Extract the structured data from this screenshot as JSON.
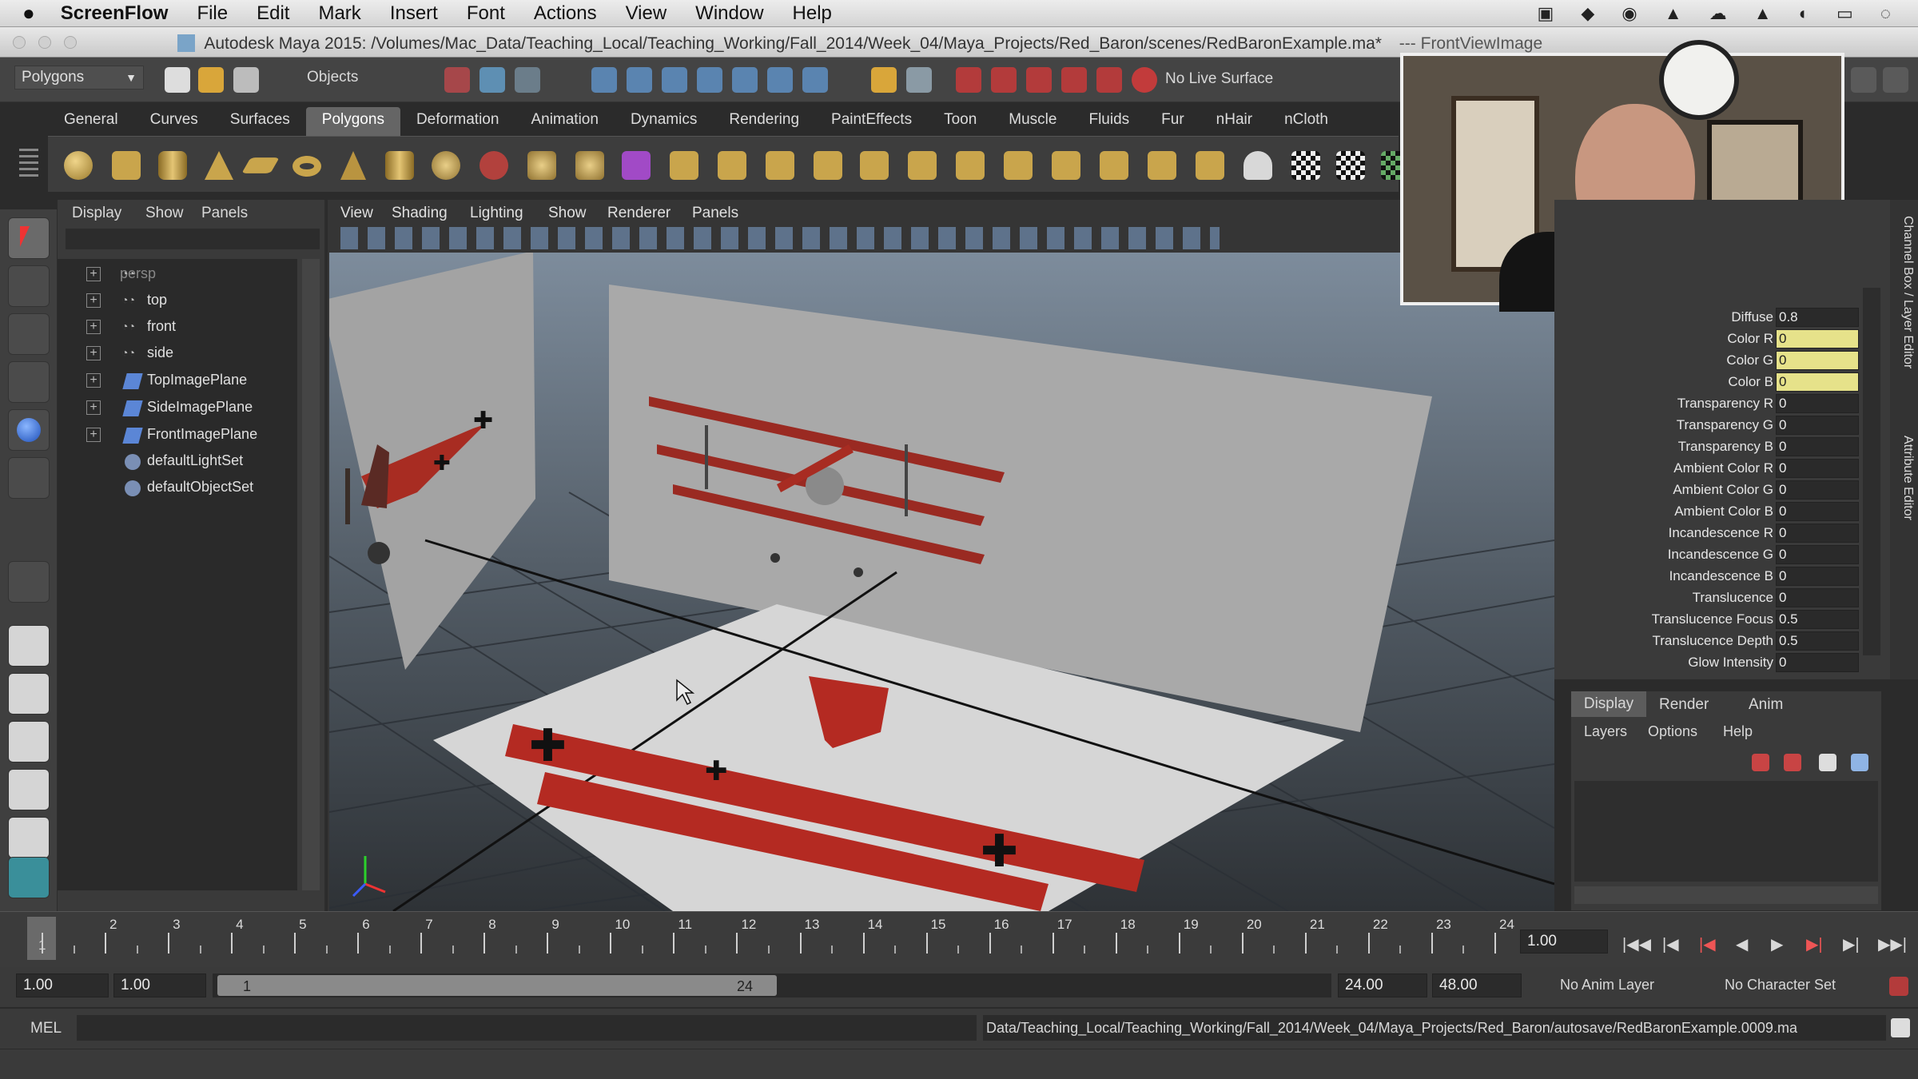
{
  "menubar": {
    "app": "ScreenFlow",
    "items": [
      "File",
      "Edit",
      "Mark",
      "Insert",
      "Font",
      "Actions",
      "View",
      "Window",
      "Help"
    ]
  },
  "window": {
    "title": "Autodesk Maya 2015: /Volumes/Mac_Data/Teaching_Local/Teaching_Working/Fall_2014/Week_04/Maya_Projects/Red_Baron/scenes/RedBaronExample.ma*",
    "title_right": "---   FrontViewImage"
  },
  "toolbar": {
    "menuset": "Polygons",
    "selection_mode": "Objects",
    "live_surface": "No Live Surface"
  },
  "shelf": {
    "tabs": [
      "General",
      "Curves",
      "Surfaces",
      "Polygons",
      "Deformation",
      "Animation",
      "Dynamics",
      "Rendering",
      "PaintEffects",
      "Toon",
      "Muscle",
      "Fluids",
      "Fur",
      "nHair",
      "nCloth"
    ],
    "active": "Polygons"
  },
  "outliner": {
    "menu": [
      "Display",
      "Show",
      "Panels"
    ],
    "items": [
      "persp",
      "top",
      "front",
      "side",
      "TopImagePlane",
      "SideImagePlane",
      "FrontImagePlane",
      "defaultLightSet",
      "defaultObjectSet"
    ]
  },
  "viewport": {
    "menu": [
      "View",
      "Shading",
      "Lighting",
      "Show",
      "Renderer",
      "Panels"
    ]
  },
  "channel_box": {
    "attributes": [
      {
        "label": "Diffuse",
        "value": "0.8"
      },
      {
        "label": "Color R",
        "value": "0"
      },
      {
        "label": "Color G",
        "value": "0"
      },
      {
        "label": "Color B",
        "value": "0"
      },
      {
        "label": "Transparency R",
        "value": "0"
      },
      {
        "label": "Transparency G",
        "value": "0"
      },
      {
        "label": "Transparency B",
        "value": "0"
      },
      {
        "label": "Ambient Color R",
        "value": "0"
      },
      {
        "label": "Ambient Color G",
        "value": "0"
      },
      {
        "label": "Ambient Color B",
        "value": "0"
      },
      {
        "label": "Incandescence R",
        "value": "0"
      },
      {
        "label": "Incandescence G",
        "value": "0"
      },
      {
        "label": "Incandescence B",
        "value": "0"
      },
      {
        "label": "Translucence",
        "value": "0"
      },
      {
        "label": "Translucence Focus",
        "value": "0.5"
      },
      {
        "label": "Translucence Depth",
        "value": "0.5"
      },
      {
        "label": "Glow Intensity",
        "value": "0"
      }
    ],
    "side_tabs": [
      "Channel Box / Layer Editor",
      "Attribute Editor"
    ]
  },
  "layer_editor": {
    "tabs": [
      "Display",
      "Render",
      "Anim"
    ],
    "menu": [
      "Layers",
      "Options",
      "Help"
    ]
  },
  "timeline": {
    "ticks": [
      "1",
      "2",
      "3",
      "4",
      "5",
      "6",
      "7",
      "8",
      "9",
      "10",
      "11",
      "12",
      "13",
      "14",
      "15",
      "16",
      "17",
      "18",
      "19",
      "20",
      "21",
      "22",
      "23",
      "24"
    ],
    "current_frame": "1",
    "current_time": "1.00"
  },
  "range": {
    "start": "1.00",
    "playback_start": "1.00",
    "slider_start": "1",
    "slider_end": "24",
    "playback_end": "24.00",
    "end": "48.00",
    "anim_layer": "No Anim Layer",
    "character_set": "No Character Set"
  },
  "command": {
    "label": "MEL",
    "result": "Data/Teaching_Local/Teaching_Working/Fall_2014/Week_04/Maya_Projects/Red_Baron/autosave/RedBaronExample.0009.ma"
  },
  "colors": {
    "highlight": "#e6e28a",
    "plane_red": "#b42a22",
    "ui_dark": "#3a3a3a"
  }
}
